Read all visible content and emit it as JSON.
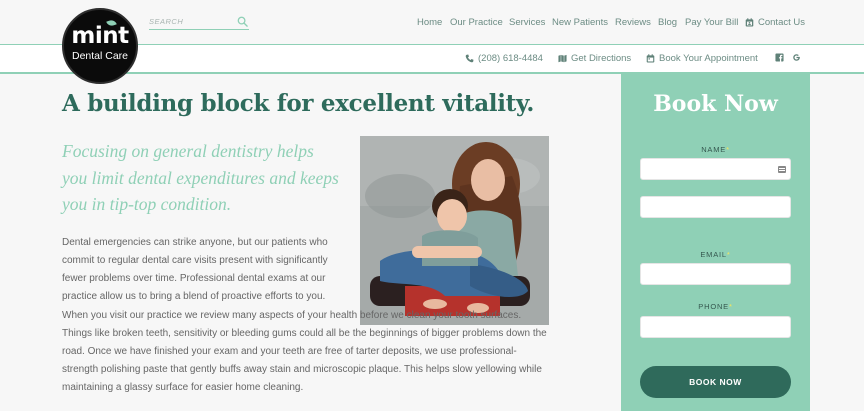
{
  "logo": {
    "brand": "mint",
    "subtitle": "Dental Care"
  },
  "search": {
    "placeholder": "SEARCH"
  },
  "nav": {
    "items": [
      "Home",
      "Our Practice",
      "Services",
      "New Patients",
      "Reviews",
      "Blog",
      "Pay Your Bill"
    ],
    "contact": "Contact Us"
  },
  "subnav": {
    "phone": "(208) 618-4484",
    "directions": "Get Directions",
    "book": "Book Your Appointment"
  },
  "main": {
    "title": "A building block for excellent vitality.",
    "lead": "Focusing on general dentistry helps you limit dental expenditures and keeps you in tip-top condition.",
    "paragraph1": "Dental emergencies can strike anyone, but our patients who commit to regular dental care visits present with significantly fewer problems over time. Professional dental exams at our practice allow us to bring a blend of proactive efforts to you.",
    "paragraph2": "When you visit our practice we review many aspects of your health before we clean your tooth surfaces. Things like broken teeth, sensitivity or bleeding gums could all be the beginnings of bigger problems down the road. Once we have finished your exam and your teeth are free of tarter deposits, we use professional-strength polishing paste that gently buffs away stain and microscopic plaque. This helps slow yellowing while maintaining a glassy surface for easier home cleaning."
  },
  "booking": {
    "title": "Book Now",
    "name_label": "NAME",
    "email_label": "EMAIL",
    "phone_label": "PHONE",
    "required_mark": "*",
    "button": "BOOK NOW"
  },
  "colors": {
    "mint": "#8fd0b6",
    "dark_green": "#2e6b5c",
    "button": "#2f6a5b"
  },
  "icons": [
    "search-icon",
    "calendar-icon",
    "phone-icon",
    "map-icon",
    "calendar-icon",
    "facebook-icon",
    "google-icon",
    "contact-card-icon"
  ]
}
